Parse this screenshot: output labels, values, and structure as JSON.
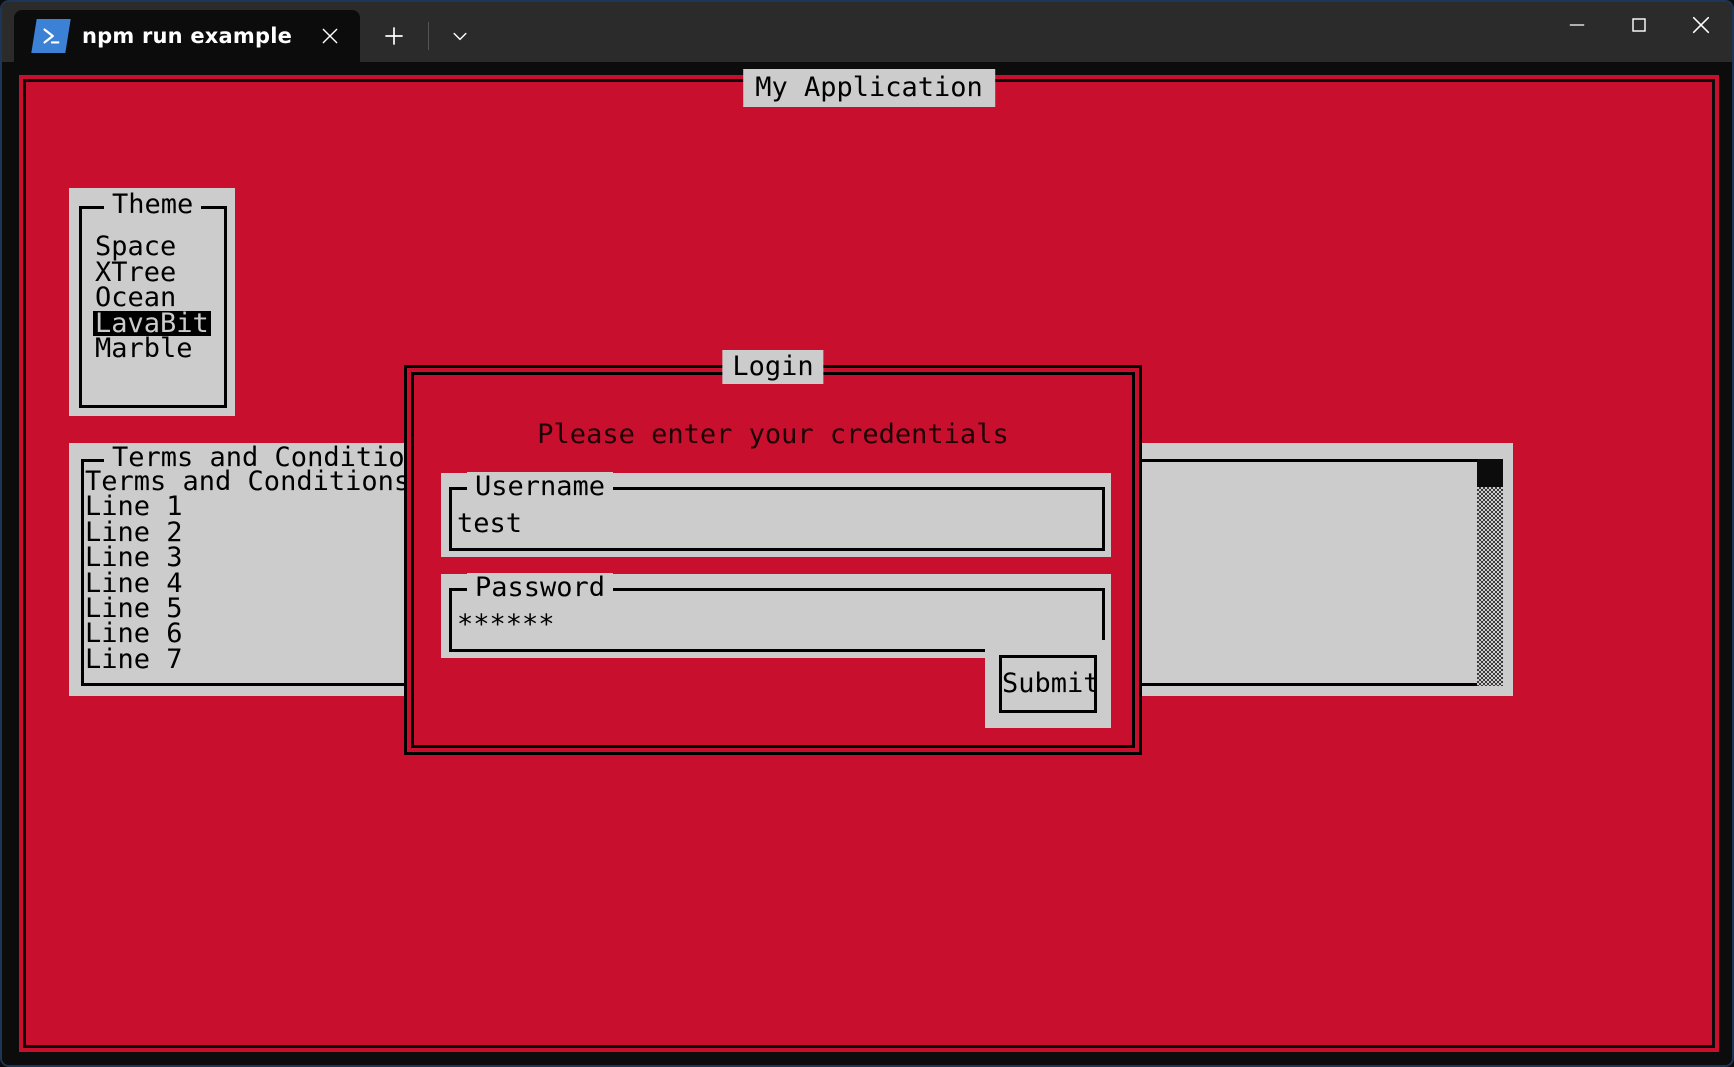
{
  "terminal": {
    "tab": {
      "title": "npm run example",
      "icon": "powershell-icon",
      "close_icon": "close-icon"
    },
    "new_tab_icon": "plus-icon",
    "tab_dropdown_icon": "chevron-down-icon",
    "window_controls": {
      "minimize_icon": "minimize-icon",
      "maximize_icon": "maximize-icon",
      "close_icon": "close-icon"
    }
  },
  "app": {
    "title": "My Application",
    "colors": {
      "background": "#c8102e",
      "panel": "#cccccc",
      "text": "#000000",
      "selection_background": "#000000",
      "selection_text": "#cccccc"
    }
  },
  "theme_box": {
    "legend": "Theme",
    "items": [
      {
        "label": "Space",
        "selected": false
      },
      {
        "label": "XTree",
        "selected": false
      },
      {
        "label": "Ocean",
        "selected": false
      },
      {
        "label": "LavaBit",
        "selected": true
      },
      {
        "label": "Marble",
        "selected": false
      }
    ]
  },
  "terms_box": {
    "legend": "Terms and Conditions",
    "lines": [
      "Terms and Conditions...",
      "Line 1",
      "Line 2",
      "Line 3",
      "Line 4",
      "Line 5",
      "Line 6",
      "Line 7"
    ]
  },
  "login_dialog": {
    "title": "Login",
    "prompt": "Please enter your credentials",
    "username": {
      "label": "Username",
      "value": "test"
    },
    "password": {
      "label": "Password",
      "value": "******"
    },
    "submit_label": "Submit"
  }
}
